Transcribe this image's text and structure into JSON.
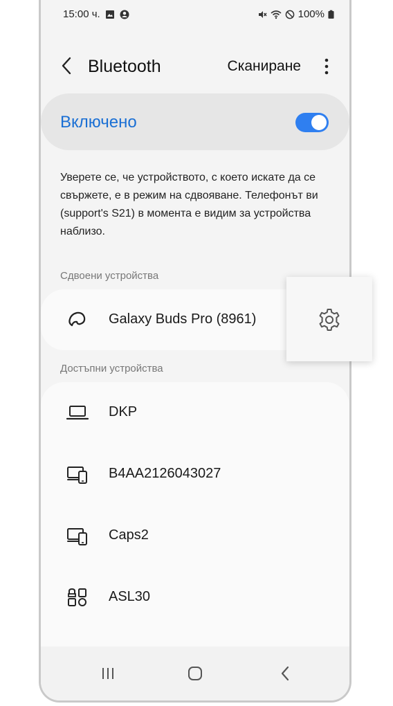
{
  "status_bar": {
    "time": "15:00 ч.",
    "battery": "100%",
    "icons_left": [
      "image-icon",
      "account-icon"
    ],
    "icons_right": [
      "mute-icon",
      "wifi-icon",
      "do-not-disturb-icon",
      "battery-icon"
    ]
  },
  "header": {
    "title": "Bluetooth",
    "scan_label": "Сканиране"
  },
  "toggle": {
    "label": "Включено",
    "on": true,
    "accent_color": "#2f7ff0"
  },
  "info_text": "Уверете се, че устройството, с което искате да се свържете, е в режим на сдвояване. Телефонът ви (support's S21) в момента е видим за устройства наблизо.",
  "paired_section": {
    "label": "Сдвоени устройства",
    "devices": [
      {
        "name": "Galaxy Buds Pro (8961)",
        "icon": "earbuds-icon"
      }
    ]
  },
  "available_section": {
    "label": "Достъпни устройства",
    "devices": [
      {
        "name": "DKP",
        "icon": "laptop-icon"
      },
      {
        "name": "B4AA2126043027",
        "icon": "devices-icon"
      },
      {
        "name": "Caps2",
        "icon": "devices-icon"
      },
      {
        "name": "ASL30",
        "icon": "generic-device-icon"
      }
    ]
  }
}
